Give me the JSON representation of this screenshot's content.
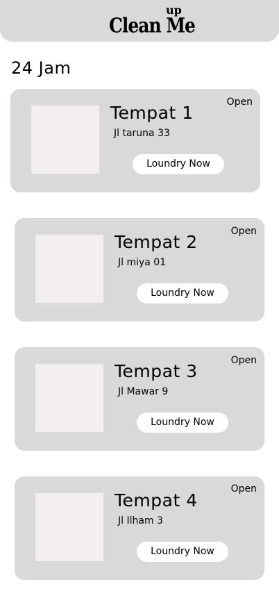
{
  "header": {
    "logo_text": "Clean Me",
    "logo_superscript": "up"
  },
  "section_title": "24 Jam",
  "places": [
    {
      "name": "Tempat 1",
      "address": "Jl taruna 33",
      "status": "Open",
      "button_label": "Loundry Now"
    },
    {
      "name": "Tempat 2",
      "address": "Jl miya 01",
      "status": "Open",
      "button_label": "Loundry Now"
    },
    {
      "name": "Tempat 3",
      "address": "Jl Mawar 9",
      "status": "Open",
      "button_label": "Loundry Now"
    },
    {
      "name": "Tempat 4",
      "address": "Jl Ilham 3",
      "status": "Open",
      "button_label": "Loundry Now"
    }
  ]
}
